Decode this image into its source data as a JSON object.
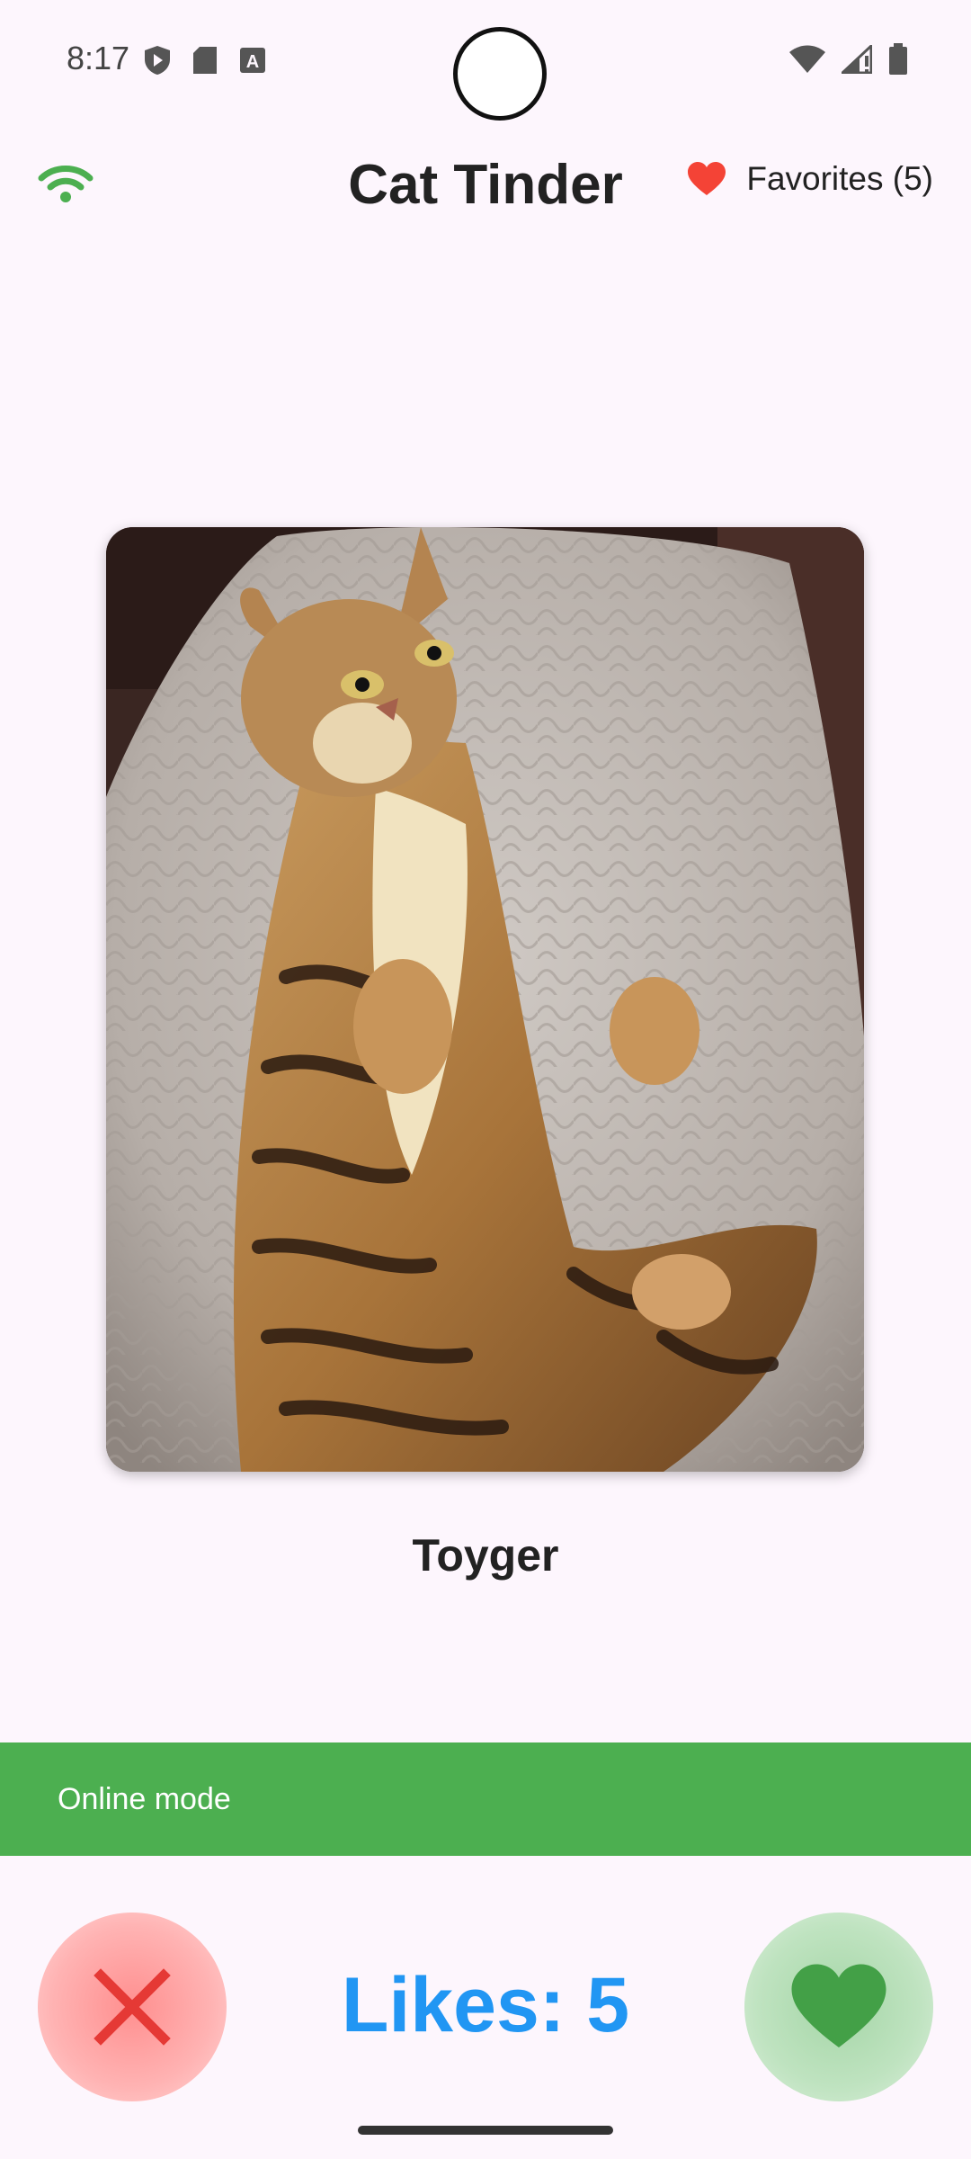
{
  "status_bar": {
    "time": "8:17"
  },
  "app_bar": {
    "title": "Cat Tinder",
    "favorites_label": "Favorites (5)"
  },
  "cat": {
    "breed": "Toyger"
  },
  "banner": {
    "mode": "Online mode",
    "color": "#4caf50"
  },
  "bottom": {
    "likes": "Likes: 5",
    "likes_color": "#2196f3"
  },
  "icons": {
    "connection": "wifi-icon",
    "favorites": "heart-icon",
    "dislike": "close-icon",
    "like": "heart-icon"
  }
}
